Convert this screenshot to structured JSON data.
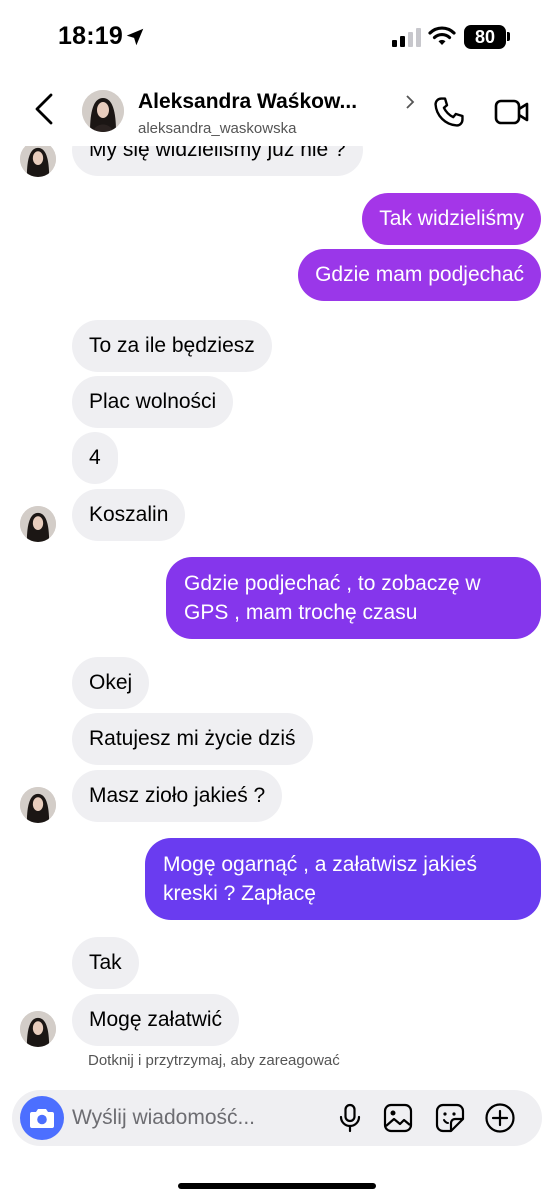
{
  "status_bar": {
    "time": "18:19",
    "battery": "80"
  },
  "header": {
    "contact_name": "Aleksandra Waśkow...",
    "username": "aleksandra_waskowska"
  },
  "messages": [
    {
      "dir": "in",
      "text": "My się widzieliśmy już nie ?"
    },
    {
      "dir": "out",
      "text": "Tak widzieliśmy"
    },
    {
      "dir": "out",
      "text": "Gdzie mam podjechać"
    },
    {
      "dir": "in",
      "text": "To za ile będziesz"
    },
    {
      "dir": "in",
      "text": "Plac wolności"
    },
    {
      "dir": "in",
      "text": "4"
    },
    {
      "dir": "in",
      "text": "Koszalin"
    },
    {
      "dir": "out",
      "text": "Gdzie podjechać , to zobaczę w GPS , mam trochę czasu"
    },
    {
      "dir": "in",
      "text": "Okej"
    },
    {
      "dir": "in",
      "text": "Ratujesz mi życie dziś"
    },
    {
      "dir": "in",
      "text": "Masz zioło jakieś ?"
    },
    {
      "dir": "out",
      "text": "Mogę ogarnąć , a załatwisz jakieś kreski ? Zapłacę"
    },
    {
      "dir": "in",
      "text": "Tak"
    },
    {
      "dir": "in",
      "text": "Mogę załatwić"
    }
  ],
  "reaction_hint": "Dotknij i przytrzymaj, aby zareagować",
  "composer": {
    "placeholder": "Wyślij wiadomość..."
  },
  "colors": {
    "accent": "#4c6fff",
    "outgoing_gradient_top": "#a436e8",
    "outgoing_gradient_bottom": "#6a3cf0",
    "incoming": "#efeff2"
  },
  "icons": [
    "back-icon",
    "phone-icon",
    "video-icon",
    "camera-icon",
    "microphone-icon",
    "gallery-icon",
    "sticker-icon",
    "plus-icon"
  ]
}
